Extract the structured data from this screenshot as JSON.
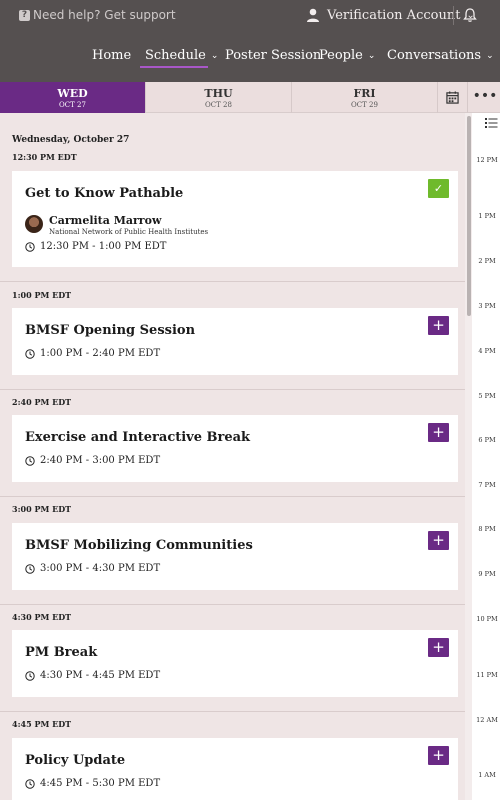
{
  "topbar": {
    "help_text": "Need help? Get support",
    "account_label": "Verification Account"
  },
  "nav": {
    "items": [
      {
        "label": "Home",
        "has_dropdown": false
      },
      {
        "label": "Schedule",
        "has_dropdown": true,
        "active": true
      },
      {
        "label": "Poster Session",
        "has_dropdown": false
      },
      {
        "label": "People",
        "has_dropdown": true
      },
      {
        "label": "Conversations",
        "has_dropdown": true
      }
    ]
  },
  "days": [
    {
      "name": "WED",
      "date": "OCT 27",
      "active": true
    },
    {
      "name": "THU",
      "date": "OCT 28",
      "active": false
    },
    {
      "name": "FRI",
      "date": "OCT 29",
      "active": false
    }
  ],
  "more_label": "•••",
  "schedule": {
    "date_heading": "Wednesday, October 27",
    "slots": [
      {
        "time_label": "12:30 PM EDT",
        "session": {
          "title": "Get to Know Pathable",
          "time": "12:30 PM - 1:00 PM EDT",
          "added": true,
          "speaker": {
            "name": "Carmelita Marrow",
            "org": "National Network of Public Health Institutes"
          }
        }
      },
      {
        "time_label": "1:00 PM EDT",
        "session": {
          "title": "BMSF Opening Session",
          "time": "1:00 PM - 2:40 PM EDT",
          "added": false
        }
      },
      {
        "time_label": "2:40 PM EDT",
        "session": {
          "title": "Exercise and Interactive Break",
          "time": "2:40 PM - 3:00 PM EDT",
          "added": false
        }
      },
      {
        "time_label": "3:00 PM EDT",
        "session": {
          "title": "BMSF Mobilizing Communities",
          "time": "3:00 PM - 4:30 PM EDT",
          "added": false
        }
      },
      {
        "time_label": "4:30 PM EDT",
        "session": {
          "title": "PM Break",
          "time": "4:30 PM - 4:45 PM EDT",
          "added": false
        }
      },
      {
        "time_label": "4:45 PM EDT",
        "session": {
          "title": "Policy Update",
          "time": "4:45 PM - 5:30 PM EDT",
          "added": false
        }
      }
    ]
  },
  "timeline": [
    "12 PM",
    "1 PM",
    "2 PM",
    "3 PM",
    "4 PM",
    "5 PM",
    "6 PM",
    "7 PM",
    "8 PM",
    "9 PM",
    "10 PM",
    "11 PM",
    "12 AM",
    "1 AM"
  ],
  "button_glyphs": {
    "add": "+",
    "added": "✓"
  },
  "colors": {
    "header_bg": "#555050",
    "accent_purple": "#6a2a85",
    "nav_underline": "#a857c8",
    "added_green": "#6fba2c",
    "page_bg": "#efe5e5"
  }
}
